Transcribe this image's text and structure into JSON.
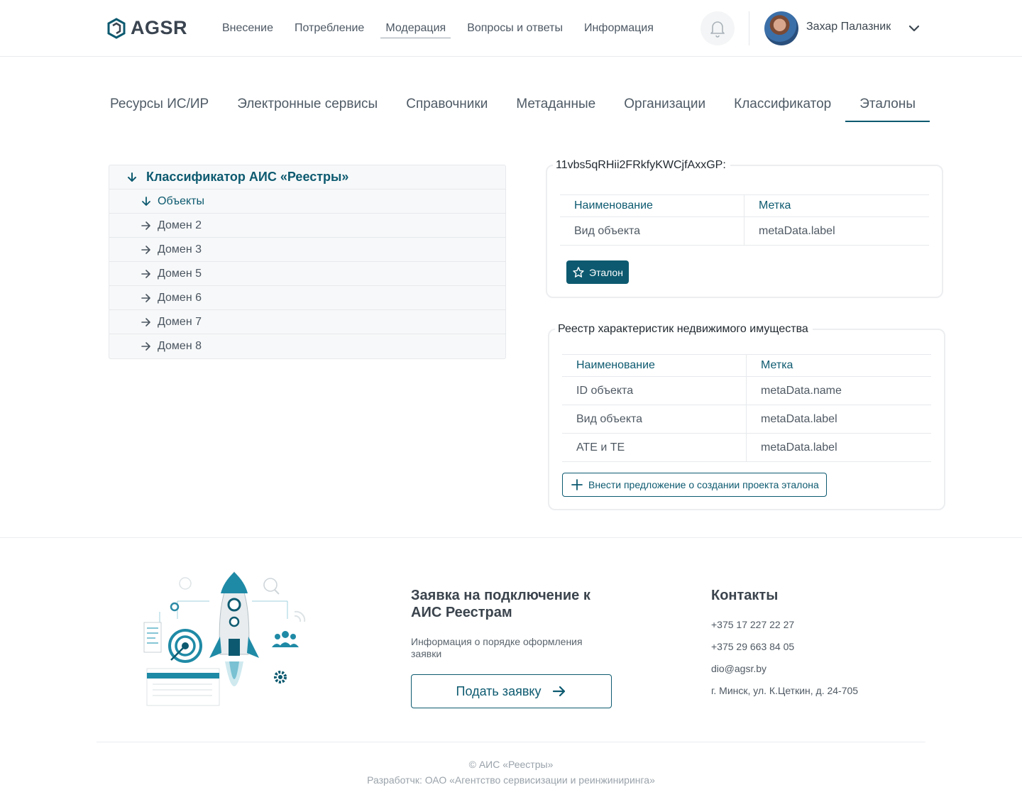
{
  "header": {
    "logo_text": "AGSR",
    "nav": [
      "Внесение",
      "Потребление",
      "Модерация",
      "Вопросы и ответы",
      "Информация"
    ],
    "active_nav": "Модерация",
    "user_name": "Захар Палазник"
  },
  "tabs": [
    "Ресурсы ИС/ИР",
    "Электронные сервисы",
    "Справочники",
    "Метаданные",
    "Организации",
    "Классификатор",
    "Эталоны"
  ],
  "active_tab": "Эталоны",
  "tree": {
    "root": "Классификатор АИС «Реестры»",
    "open_child": "Объекты",
    "children": [
      "Домен 2",
      "Домен 3",
      "Домен 5",
      "Домен 6",
      "Домен 7",
      "Домен 8"
    ]
  },
  "card1": {
    "legend": "11vbs5qRHii2FRkfyKWCjfAxxGP:",
    "headers": [
      "Наименование",
      "Метка"
    ],
    "rows": [
      [
        "Вид объекта",
        "metaData.label"
      ]
    ],
    "button_label": "Эталон"
  },
  "card2": {
    "legend": "Реестр характеристик недвижимого имущества",
    "headers": [
      "Наименование",
      "Метка"
    ],
    "rows": [
      [
        "ID объекта",
        "metaData.name"
      ],
      [
        "Вид объекта",
        "metaData.label"
      ],
      [
        "АТЕ и ТЕ",
        "metaData.label"
      ]
    ],
    "button_label": "Внести предложение о создании проекта эталона"
  },
  "footer": {
    "request_title": "Заявка на подключение к АИС Реестрам",
    "request_info": "Информация о порядке оформления заявки",
    "request_button": "Подать заявку",
    "contacts_title": "Контакты",
    "contacts": [
      "+375 17 227 22 27",
      "+375 29 663 84 05",
      "dio@agsr.by",
      "г. Минск, ул. К.Цеткин, д. 24-705"
    ],
    "copyright": "© АИС «Реестры»",
    "developer": "Разработчк: ОАО «Агентство сервисизации и реинжиниринга»"
  },
  "colors": {
    "accent": "#0d5a70",
    "border": "#e6e9ec",
    "tree_bg": "#f7f8f9"
  }
}
